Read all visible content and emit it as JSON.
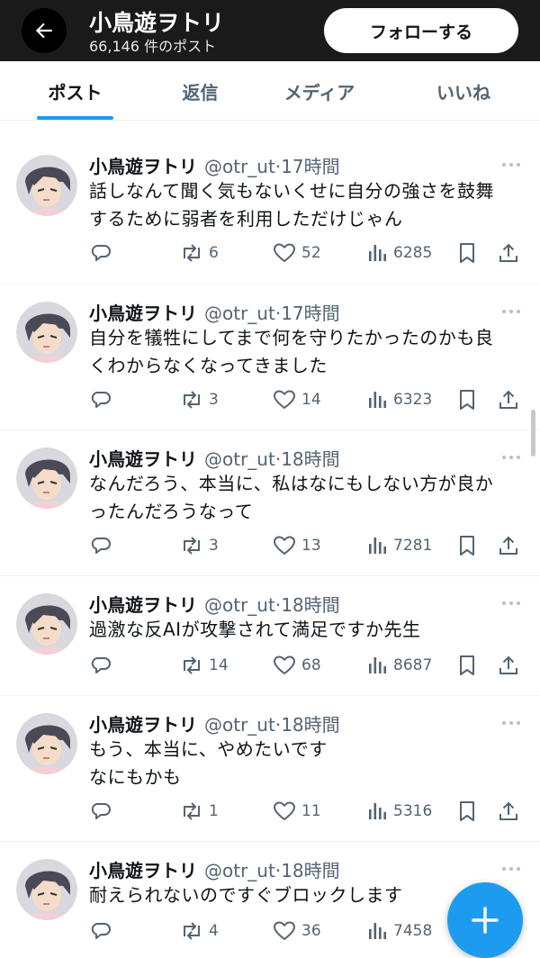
{
  "header": {
    "back_icon": "arrow-left-icon",
    "title": "小鳥遊ヲトリ",
    "post_count": "66,146 件のポスト",
    "follow_label": "フォローする"
  },
  "tabs": [
    {
      "label": "ポスト",
      "active": true
    },
    {
      "label": "返信",
      "active": false
    },
    {
      "label": "メディア",
      "active": false
    },
    {
      "label": "いいね",
      "active": false
    }
  ],
  "posts": [
    {
      "name": "小鳥遊ヲトリ",
      "handle": "@otr_ut",
      "time": "17時間",
      "lines": [
        "話しなんて聞く気もないくせに自分の強さを鼓舞",
        "するために弱者を利用しただけじゃん"
      ],
      "reply_count": "",
      "repost_count": "6",
      "like_count": "52",
      "view_count": "6285"
    },
    {
      "name": "小鳥遊ヲトリ",
      "handle": "@otr_ut",
      "time": "17時間",
      "lines": [
        "自分を犠牲にしてまで何を守りたかったのかも良",
        "くわからなくなってきました"
      ],
      "reply_count": "",
      "repost_count": "3",
      "like_count": "14",
      "view_count": "6323"
    },
    {
      "name": "小鳥遊ヲトリ",
      "handle": "@otr_ut",
      "time": "18時間",
      "lines": [
        "なんだろう、本当に、私はなにもしない方が良か",
        "ったんだろうなって"
      ],
      "reply_count": "",
      "repost_count": "3",
      "like_count": "13",
      "view_count": "7281"
    },
    {
      "name": "小鳥遊ヲトリ",
      "handle": "@otr_ut",
      "time": "18時間",
      "lines": [
        "過激な反AIが攻撃されて満足ですか先生"
      ],
      "reply_count": "",
      "repost_count": "14",
      "like_count": "68",
      "view_count": "8687"
    },
    {
      "name": "小鳥遊ヲトリ",
      "handle": "@otr_ut",
      "time": "18時間",
      "lines": [
        "もう、本当に、やめたいです",
        "なにもかも"
      ],
      "reply_count": "",
      "repost_count": "1",
      "like_count": "11",
      "view_count": "5316"
    },
    {
      "name": "小鳥遊ヲトリ",
      "handle": "@otr_ut",
      "time": "18時間",
      "lines": [
        "耐えられないのですぐブロックします"
      ],
      "reply_count": "",
      "repost_count": "4",
      "like_count": "36",
      "view_count": "7458"
    }
  ],
  "fab_icon": "plus-icon",
  "colors": {
    "accent": "#1d9bf0",
    "header_bg": "#1a1a1a",
    "muted": "#536471"
  }
}
